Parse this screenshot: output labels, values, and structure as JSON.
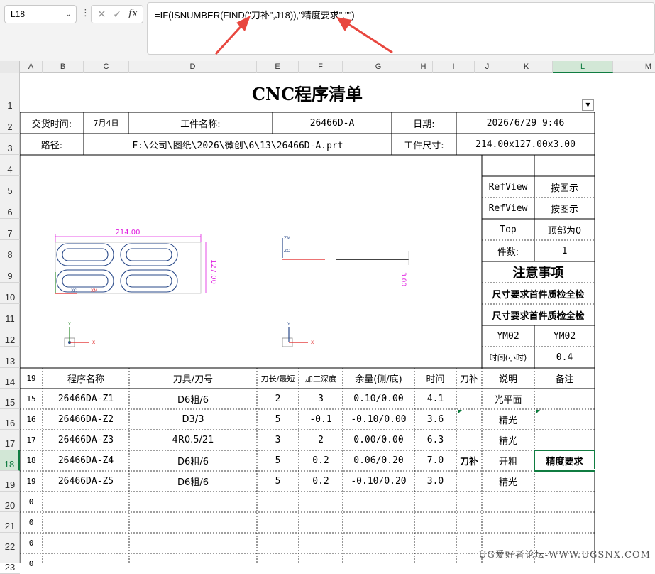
{
  "formula_bar": {
    "name_box": "L18",
    "cancel_glyph": "✕",
    "confirm_glyph": "✓",
    "fx_label": "fx",
    "formula": "=IF(ISNUMBER(FIND(\"刀补\",J18)),\"精度要求\",\"\")"
  },
  "columns": [
    "A",
    "B",
    "C",
    "D",
    "E",
    "F",
    "G",
    "H",
    "I",
    "J",
    "K",
    "L",
    "M"
  ],
  "selected_column": "L",
  "rows": [
    "1",
    "2",
    "3",
    "4",
    "5",
    "6",
    "7",
    "8",
    "9",
    "10",
    "11",
    "12",
    "13",
    "14",
    "15",
    "16",
    "17",
    "18",
    "19",
    "20",
    "21",
    "22",
    "23"
  ],
  "selected_row": "18",
  "sheet": {
    "title": "CNC程序清单",
    "delivery_label": "交货时间:",
    "delivery_value": "7月4日",
    "part_name_label": "工件名称:",
    "part_name_value": "26466D-A",
    "date_label": "日期:",
    "date_value": "2026/6/29 9:46",
    "path_label": "路径:",
    "path_value": "F:\\公司\\图纸\\2026\\微创\\6\\13\\26466D-A.prt",
    "size_label": "工件尺寸:",
    "size_value": "214.00x127.00x3.00",
    "info": [
      {
        "k": "RefView",
        "v": "按图示"
      },
      {
        "k": "RefView",
        "v": "按图示"
      },
      {
        "k": "Top",
        "v": "顶部为0"
      },
      {
        "k": "件数:",
        "v": "1"
      }
    ],
    "notes_title": "注意事项",
    "note1": "尺寸要求首件质检全检",
    "note2": "尺寸要求首件质检全检",
    "ym_k": "YM02",
    "ym_v": "YM02",
    "time_label": "时间(小时)",
    "time_value": "0.4",
    "drawing": {
      "width_dim": "214.00",
      "height_dim": "127.00",
      "thickness_dim": "3.00",
      "axis_zm": "ZM",
      "axis_zc": "ZC",
      "axis_xm": "XM",
      "axis_xc": "XC",
      "axis_x": "X",
      "axis_y": "Y"
    },
    "headers": [
      "19",
      "程序名称",
      "刀具/刀号",
      "刀长/最短",
      "加工深度",
      "余量(侧/底)",
      "时间",
      "刀补",
      "说明",
      "备注"
    ],
    "programs": [
      {
        "no": "15",
        "name": "26466DA-Z1",
        "tool": "D6粗/6",
        "len": "2",
        "depth": "3",
        "allow": "0.10/0.00",
        "time": "4.1",
        "comp": "",
        "desc": "光平面",
        "note": ""
      },
      {
        "no": "16",
        "name": "26466DA-Z2",
        "tool": "D3/3",
        "len": "5",
        "depth": "-0.1",
        "allow": "-0.10/0.00",
        "time": "3.6",
        "comp": "",
        "desc": "精光",
        "note": ""
      },
      {
        "no": "17",
        "name": "26466DA-Z3",
        "tool": "4R0.5/21",
        "len": "3",
        "depth": "2",
        "allow": "0.00/0.00",
        "time": "6.3",
        "comp": "",
        "desc": "精光",
        "note": ""
      },
      {
        "no": "18",
        "name": "26466DA-Z4",
        "tool": "D6粗/6",
        "len": "5",
        "depth": "0.2",
        "allow": "0.06/0.20",
        "time": "7.0",
        "comp": "刀补",
        "desc": "开粗",
        "note": "精度要求"
      },
      {
        "no": "19",
        "name": "26466DA-Z5",
        "tool": "D6粗/6",
        "len": "5",
        "depth": "0.2",
        "allow": "-0.10/0.20",
        "time": "3.0",
        "comp": "",
        "desc": "精光",
        "note": ""
      }
    ],
    "empty_row_no": [
      "0",
      "0",
      "0",
      "0"
    ]
  },
  "watermark": "UG爱好者论坛-WWW.UGSNX.COM",
  "colors": {
    "accent": "#107c41",
    "arrow": "#e8473f",
    "drawing_blue": "#2a4a8a",
    "dim_magenta": "#e020e0"
  }
}
